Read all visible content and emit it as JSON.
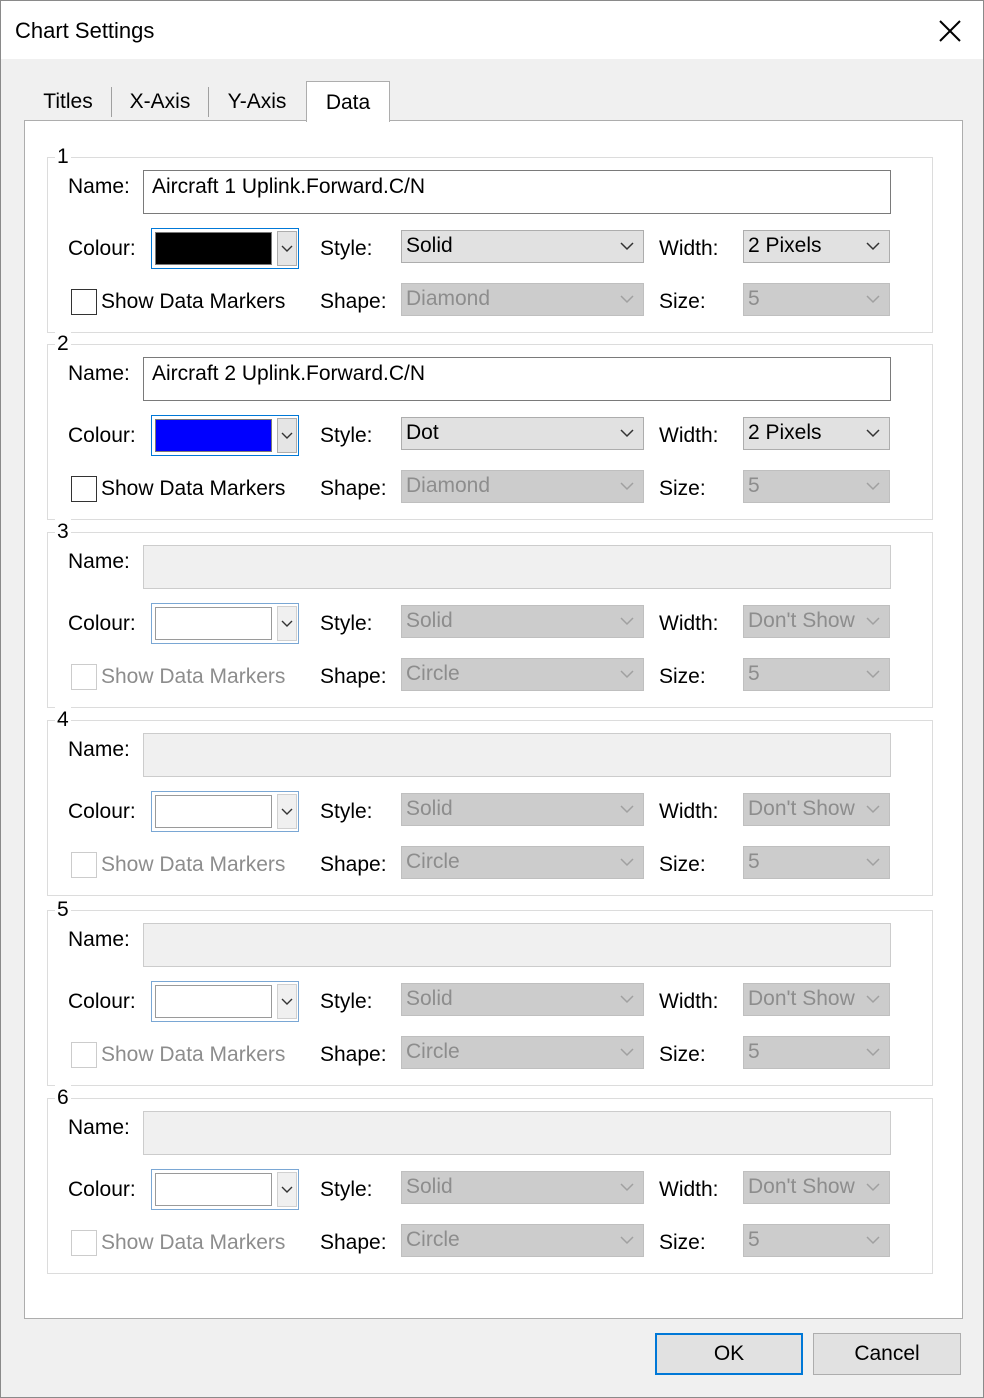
{
  "window": {
    "title": "Chart Settings"
  },
  "tabs": [
    {
      "label": "Titles"
    },
    {
      "label": "X-Axis"
    },
    {
      "label": "Y-Axis"
    },
    {
      "label": "Data",
      "active": true
    }
  ],
  "labels": {
    "name": "Name:",
    "colour": "Colour:",
    "style": "Style:",
    "width": "Width:",
    "show_markers": "Show Data Markers",
    "shape": "Shape:",
    "size": "Size:"
  },
  "series": [
    {
      "number": "1",
      "name": "Aircraft 1 Uplink.Forward.C/N",
      "colour": "#000000",
      "style": "Solid",
      "width": "2 Pixels",
      "show_markers": false,
      "shape": "Diamond",
      "size": "5",
      "enabled": true
    },
    {
      "number": "2",
      "name": "Aircraft 2 Uplink.Forward.C/N",
      "colour": "#0000ff",
      "style": "Dot",
      "width": "2 Pixels",
      "show_markers": false,
      "shape": "Diamond",
      "size": "5",
      "enabled": true
    },
    {
      "number": "3",
      "name": "",
      "colour": "#ffffff",
      "style": "Solid",
      "width": "Don't Show",
      "show_markers": false,
      "shape": "Circle",
      "size": "5",
      "enabled": false
    },
    {
      "number": "4",
      "name": "",
      "colour": "#ffffff",
      "style": "Solid",
      "width": "Don't Show",
      "show_markers": false,
      "shape": "Circle",
      "size": "5",
      "enabled": false
    },
    {
      "number": "5",
      "name": "",
      "colour": "#ffffff",
      "style": "Solid",
      "width": "Don't Show",
      "show_markers": false,
      "shape": "Circle",
      "size": "5",
      "enabled": false
    },
    {
      "number": "6",
      "name": "",
      "colour": "#ffffff",
      "style": "Solid",
      "width": "Don't Show",
      "show_markers": false,
      "shape": "Circle",
      "size": "5",
      "enabled": false
    }
  ],
  "buttons": {
    "ok": "OK",
    "cancel": "Cancel"
  },
  "theme": {
    "accent": "#0078d7"
  }
}
